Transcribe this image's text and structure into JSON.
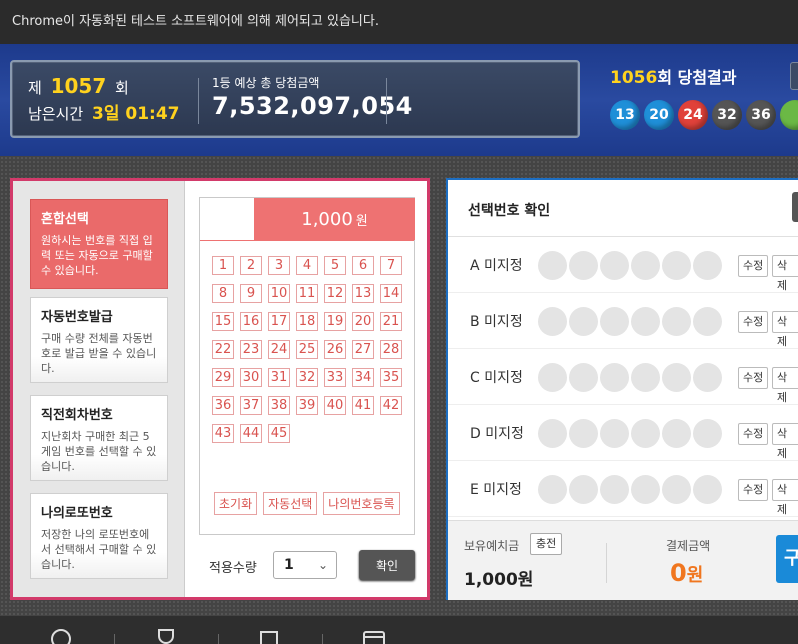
{
  "infobar": {
    "text": "Chrome이 자동화된 테스트 소프트웨어에 의해 제어되고 있습니다."
  },
  "draw": {
    "prefix": "제",
    "round": "1057",
    "suffix": "회",
    "remain_label": "남은시간",
    "remain_value": "3일 01:47",
    "prize_label": "1등 예상 총 당첨금액",
    "prize_amount": "7,532,097,054"
  },
  "last_result": {
    "round": "1056",
    "title_suffix": "회 당첨결과",
    "numbers": [
      {
        "value": "13",
        "color": "#1f8fd8"
      },
      {
        "value": "20",
        "color": "#1f8fd8"
      },
      {
        "value": "24",
        "color": "#e0413a"
      },
      {
        "value": "32",
        "color": "#555555"
      },
      {
        "value": "36",
        "color": "#555555"
      },
      {
        "value": "",
        "color": "#6bb845"
      }
    ]
  },
  "menu": [
    {
      "title": "혼합선택",
      "desc": "원하시는 번호를 직접 입력 또는 자동으로 구매할 수 있습니다.",
      "active": true
    },
    {
      "title": "자동번호발급",
      "desc": "구매 수량 전체를 자동번호로 발급 받을 수 있습니다.",
      "active": false
    },
    {
      "title": "직전회차번호",
      "desc": "지난회차 구매한 최근 5게임 번호를 선택할 수 있습니다.",
      "active": false
    },
    {
      "title": "나의로또번호",
      "desc": "저장한 나의 로또번호에서 선택해서 구매할 수 있습니다.",
      "active": false
    }
  ],
  "grid": {
    "price": "1,000",
    "price_unit": "원",
    "numbers": [
      "1",
      "2",
      "3",
      "4",
      "5",
      "6",
      "7",
      "8",
      "9",
      "10",
      "11",
      "12",
      "13",
      "14",
      "15",
      "16",
      "17",
      "18",
      "19",
      "20",
      "21",
      "22",
      "23",
      "24",
      "25",
      "26",
      "27",
      "28",
      "29",
      "30",
      "31",
      "32",
      "33",
      "34",
      "35",
      "36",
      "37",
      "38",
      "39",
      "40",
      "41",
      "42",
      "43",
      "44",
      "45"
    ],
    "reset_label": "초기화",
    "auto_label": "자동선택",
    "register_label": "나의번호등록"
  },
  "quantity": {
    "label": "적용수량",
    "value": "1",
    "confirm_label": "확인"
  },
  "selection": {
    "title": "선택번호 확인",
    "rows": [
      {
        "label": "A 미지정"
      },
      {
        "label": "B 미지정"
      },
      {
        "label": "C 미지정"
      },
      {
        "label": "D 미지정"
      },
      {
        "label": "E 미지정"
      }
    ],
    "edit_label": "수정",
    "delete_label": "삭제"
  },
  "footer": {
    "balance_label": "보유예치금",
    "charge_label": "충전",
    "balance_value": "1,000원",
    "pay_label": "결제금액",
    "pay_value": "0",
    "pay_unit": "원",
    "buy_label": "구"
  },
  "bottom_icons": [
    "help-icon",
    "trophy-icon",
    "store-icon",
    "card-icon"
  ]
}
